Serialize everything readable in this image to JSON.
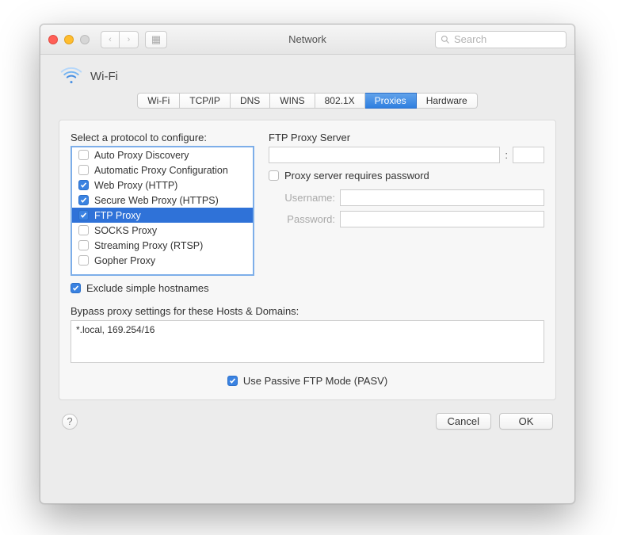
{
  "title": "Network",
  "search": {
    "placeholder": "Search"
  },
  "header": {
    "label": "Wi-Fi"
  },
  "tabs": [
    {
      "id": "wifi",
      "label": "Wi-Fi"
    },
    {
      "id": "tcpip",
      "label": "TCP/IP"
    },
    {
      "id": "dns",
      "label": "DNS"
    },
    {
      "id": "wins",
      "label": "WINS"
    },
    {
      "id": "8021x",
      "label": "802.1X"
    },
    {
      "id": "proxies",
      "label": "Proxies"
    },
    {
      "id": "hardware",
      "label": "Hardware"
    }
  ],
  "tabs_active": "proxies",
  "protocols": {
    "label": "Select a protocol to configure:",
    "items": [
      {
        "label": "Auto Proxy Discovery",
        "checked": false,
        "selected": false
      },
      {
        "label": "Automatic Proxy Configuration",
        "checked": false,
        "selected": false
      },
      {
        "label": "Web Proxy (HTTP)",
        "checked": true,
        "selected": false
      },
      {
        "label": "Secure Web Proxy (HTTPS)",
        "checked": true,
        "selected": false
      },
      {
        "label": "FTP Proxy",
        "checked": true,
        "selected": true
      },
      {
        "label": "SOCKS Proxy",
        "checked": false,
        "selected": false
      },
      {
        "label": "Streaming Proxy (RTSP)",
        "checked": false,
        "selected": false
      },
      {
        "label": "Gopher Proxy",
        "checked": false,
        "selected": false
      }
    ]
  },
  "exclude_simple": {
    "label": "Exclude simple hostnames",
    "checked": true
  },
  "server": {
    "label": "FTP Proxy Server",
    "address": "",
    "port": "",
    "requires_password_label": "Proxy server requires password",
    "requires_password": false,
    "username_label": "Username:",
    "username": "",
    "password_label": "Password:",
    "password": ""
  },
  "bypass": {
    "label": "Bypass proxy settings for these Hosts & Domains:",
    "value": "*.local, 169.254/16"
  },
  "pasv": {
    "label": "Use Passive FTP Mode (PASV)",
    "checked": true
  },
  "buttons": {
    "cancel": "Cancel",
    "ok": "OK"
  },
  "help": "?"
}
